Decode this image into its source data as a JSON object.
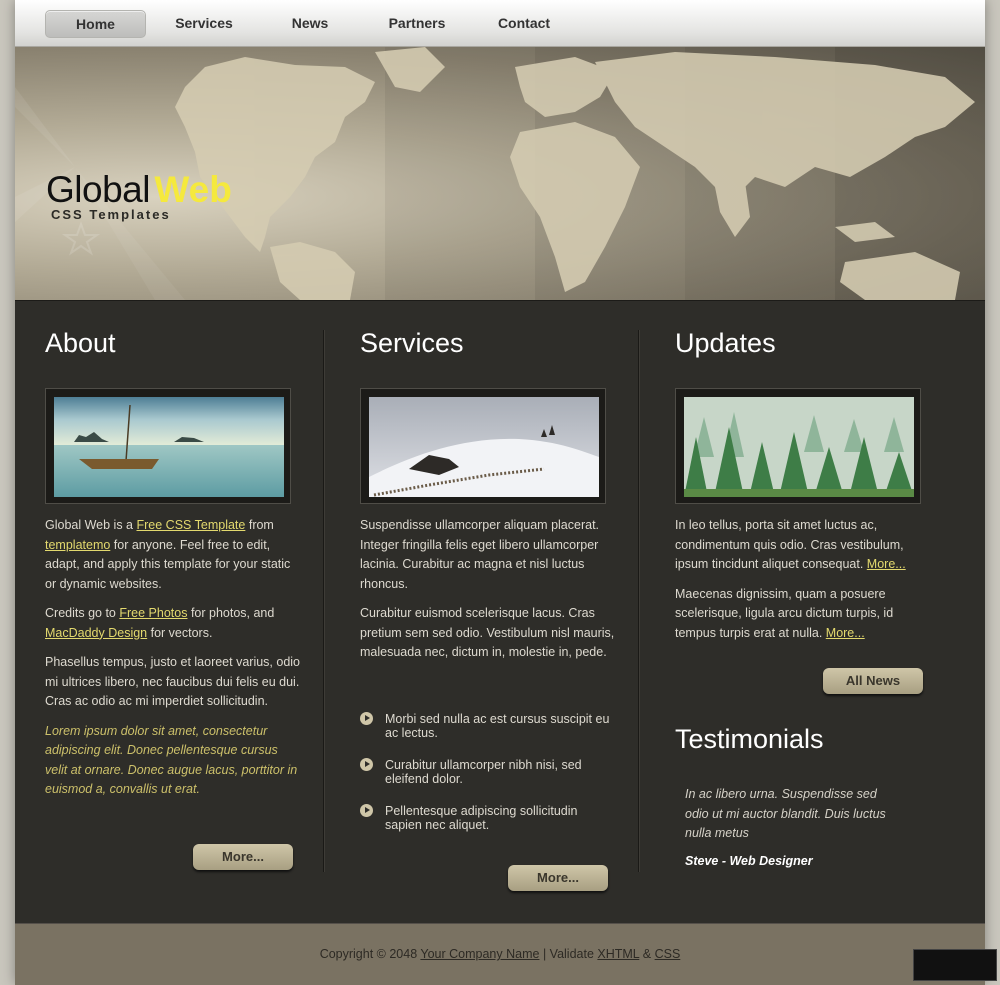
{
  "nav": {
    "items": [
      "Home",
      "Services",
      "News",
      "Partners",
      "Contact"
    ],
    "active": "Home"
  },
  "header": {
    "title_part1": "Global",
    "title_part2": "Web",
    "tagline": "CSS Templates"
  },
  "about": {
    "title": "About",
    "p1_pre": "Global Web is a",
    "p1_link1": "Free CSS Template",
    "p1_mid": "from",
    "p1_link2": "templatemo",
    "p1_post": "for anyone. Feel free to edit, adapt, and apply this template for your static or dynamic websites.",
    "p2_pre": "Credits go to",
    "p2_link1": "Free Photos",
    "p2_mid": "for photos, and",
    "p2_link2": "MacDaddy Design",
    "p2_post": "for vectors.",
    "p3": "Phasellus tempus, justo et laoreet varius, odio mi ultrices libero, nec faucibus dui felis eu dui. Cras ac odio ac mi imperdiet sollicitudin.",
    "p4": "Lorem ipsum dolor sit amet, consectetur adipiscing elit. Donec pellentesque cursus velit at ornare. Donec augue lacus, porttitor in euismod a, convallis ut erat.",
    "button": "More..."
  },
  "services": {
    "title": "Services",
    "p1": "Suspendisse ullamcorper aliquam placerat. Integer fringilla felis eget libero ullamcorper lacinia. Curabitur ac magna et nisl luctus rhoncus.",
    "p2": "Curabitur euismod scelerisque lacus. Cras pretium sem sed odio. Vestibulum nisl mauris, malesuada nec, dictum in, molestie in, pede.",
    "bullets": [
      "Morbi sed nulla ac est cursus suscipit eu ac lectus.",
      "Curabitur ullamcorper nibh nisi, sed eleifend dolor.",
      "Pellentesque adipiscing sollicitudin sapien nec aliquet."
    ],
    "button": "More..."
  },
  "updates": {
    "title": "Updates",
    "p1": "In leo tellus, porta sit amet luctus ac, condimentum quis odio. Cras vestibulum, ipsum tincidunt aliquet consequat.",
    "p1_link": "More...",
    "p2": "Maecenas dignissim, quam a posuere scelerisque, ligula arcu dictum turpis, id tempus turpis erat at nulla.",
    "p2_link": "More...",
    "button": "All News"
  },
  "testimonials": {
    "title": "Testimonials",
    "quote": "In ac libero urna. Suspendisse sed odio ut mi auctor blandit. Duis luctus nulla metus",
    "author": "Steve - Web Designer"
  },
  "footer": {
    "copyright": "Copyright © 2048",
    "company": "Your Company Name",
    "sep": "| Validate",
    "xhtml": "XHTML",
    "amp": "&",
    "css": "CSS"
  },
  "colors": {
    "accent_yellow": "#f5e93d",
    "link": "#e3d96e",
    "content_bg": "#2e2d29",
    "footer_bg": "#7a7262"
  }
}
